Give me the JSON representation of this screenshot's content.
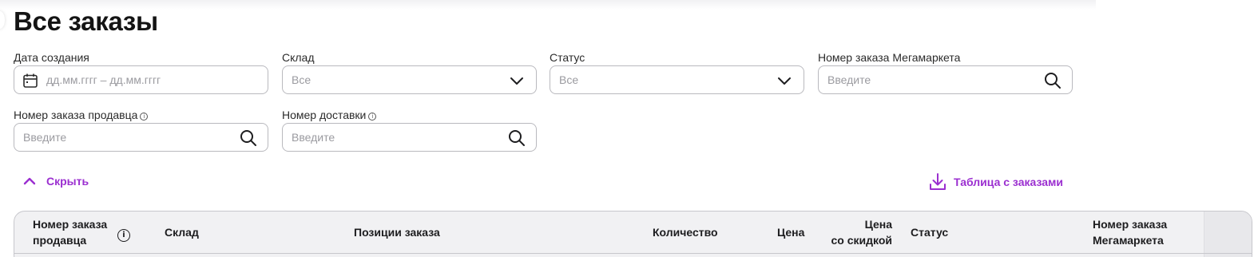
{
  "page": {
    "title": "Все заказы"
  },
  "filters": {
    "created_date": {
      "label": "Дата создания",
      "placeholder": "дд.мм.гггг – дд.мм.гггг",
      "icon": "calendar-icon"
    },
    "warehouse": {
      "label": "Склад",
      "value": "Все",
      "icon": "chevron-down-icon"
    },
    "status": {
      "label": "Статус",
      "value": "Все",
      "icon": "chevron-down-icon"
    },
    "megamarket_order": {
      "label": "Номер заказа Мегамаркета",
      "placeholder": "Введите",
      "icon": "search-icon"
    },
    "seller_order": {
      "label": "Номер заказа продавца",
      "placeholder": "Введите",
      "icon": "search-icon",
      "info": "i"
    },
    "delivery_number": {
      "label": "Номер доставки",
      "placeholder": "Введите",
      "icon": "search-icon",
      "info": "i"
    }
  },
  "actions": {
    "hide": {
      "label": "Скрыть",
      "icon": "chevron-up-icon"
    },
    "export": {
      "label": "Таблица с заказами",
      "icon": "download-icon"
    }
  },
  "table": {
    "columns": [
      {
        "key": "seller_order_1",
        "label": "Номер заказа"
      },
      {
        "key": "seller_order_2",
        "label": "продавца"
      },
      {
        "key": "warehouse",
        "label": "Склад"
      },
      {
        "key": "positions",
        "label": "Позиции заказа"
      },
      {
        "key": "quantity",
        "label": "Количество"
      },
      {
        "key": "price",
        "label": "Цена"
      },
      {
        "key": "discount_price_1",
        "label": "Цена"
      },
      {
        "key": "discount_price_2",
        "label": "со скидкой"
      },
      {
        "key": "status",
        "label": "Статус"
      },
      {
        "key": "mm_order_1",
        "label": "Номер заказа"
      },
      {
        "key": "mm_order_2",
        "label": "Мегамаркета"
      }
    ],
    "info_glyph": "i"
  },
  "colors": {
    "accent": "#9b2fd0",
    "border": "#b9b9be",
    "header_bg": "#f1f1f3"
  }
}
